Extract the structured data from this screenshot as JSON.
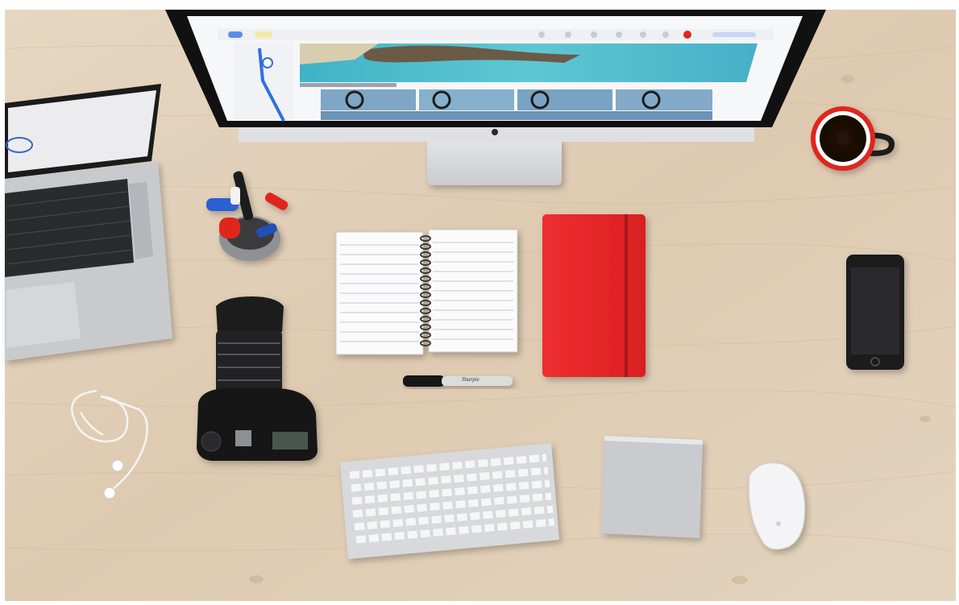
{
  "scene": {
    "kind": "photo",
    "caption": "",
    "imac_screen": {
      "gallery_label": "",
      "accent_color": "#2f6fe0"
    },
    "marker_brand": "Sharpie",
    "notebook_color": "#e8262a",
    "mug_color": "#e0261e",
    "wood_tone": "#e3d3bd"
  }
}
